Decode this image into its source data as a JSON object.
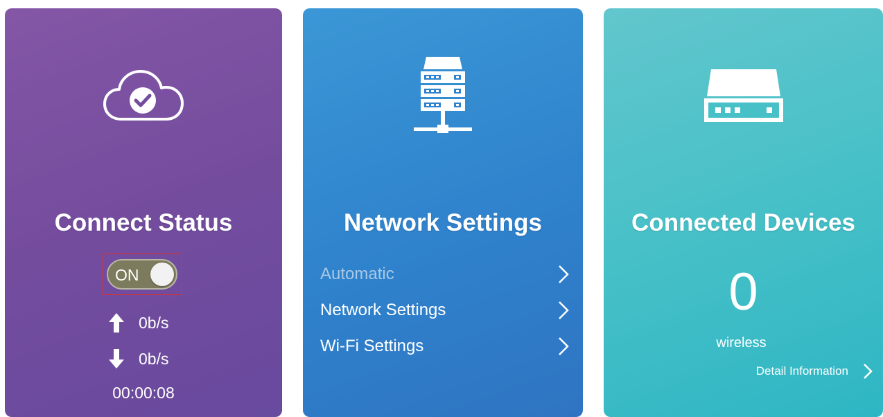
{
  "colors": {
    "connect_card": "#744c9e",
    "network_card": "#2f82cc",
    "devices_card": "#47c0c7",
    "toggle_track": "#7d7b5e",
    "highlight_outline": "#e0312b"
  },
  "connect_status": {
    "title": "Connect Status",
    "toggle_label": "ON",
    "toggle_on": true,
    "upload_rate": "0b/s",
    "download_rate": "0b/s",
    "duration": "00:00:08",
    "icon": "cloud-check-icon"
  },
  "network_settings": {
    "title": "Network Settings",
    "icon": "server-network-icon",
    "items": [
      {
        "label": "Automatic",
        "dim": true
      },
      {
        "label": "Network Settings",
        "dim": false
      },
      {
        "label": "Wi-Fi Settings",
        "dim": false
      }
    ]
  },
  "connected_devices": {
    "title": "Connected Devices",
    "icon": "router-icon",
    "count": "0",
    "kind": "wireless",
    "detail_label": "Detail Information"
  }
}
